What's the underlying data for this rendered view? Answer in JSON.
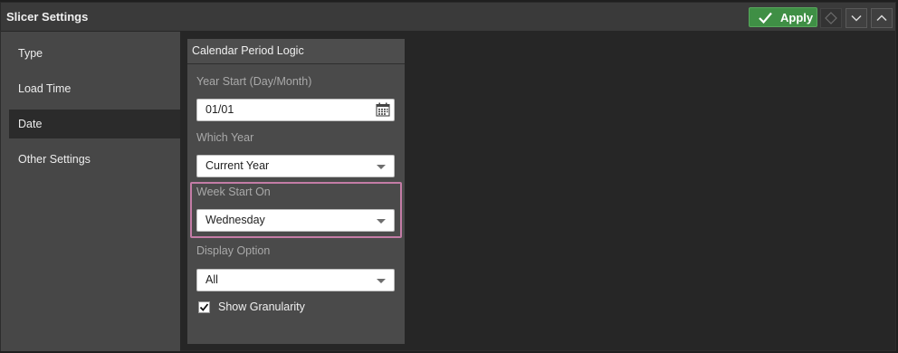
{
  "window": {
    "title": "Slicer Settings"
  },
  "toolbar": {
    "apply_label": "Apply",
    "apply_icon": "checkmark-icon",
    "diamond_icon": "diamond-icon",
    "collapse_icon": "chevron-down-icon",
    "expand_icon": "chevron-up-icon"
  },
  "sidebar": {
    "items": [
      {
        "label": "Type",
        "active": false
      },
      {
        "label": "Load Time",
        "active": false
      },
      {
        "label": "Date",
        "active": true
      },
      {
        "label": "Other Settings",
        "active": false
      }
    ]
  },
  "panel": {
    "title": "Calendar Period Logic",
    "year_start": {
      "label": "Year Start (Day/Month)",
      "value": "01/01"
    },
    "which_year": {
      "label": "Which Year",
      "value": "Current Year"
    },
    "week_start": {
      "label": "Week Start On",
      "value": "Wednesday"
    },
    "display_option": {
      "label": "Display Option",
      "value": "All"
    },
    "show_granularity": {
      "label": "Show Granularity",
      "checked": true
    }
  },
  "colors": {
    "accent": "#3f8f45",
    "highlight": "#c47ca6",
    "active_item": "#2b2b2b"
  }
}
